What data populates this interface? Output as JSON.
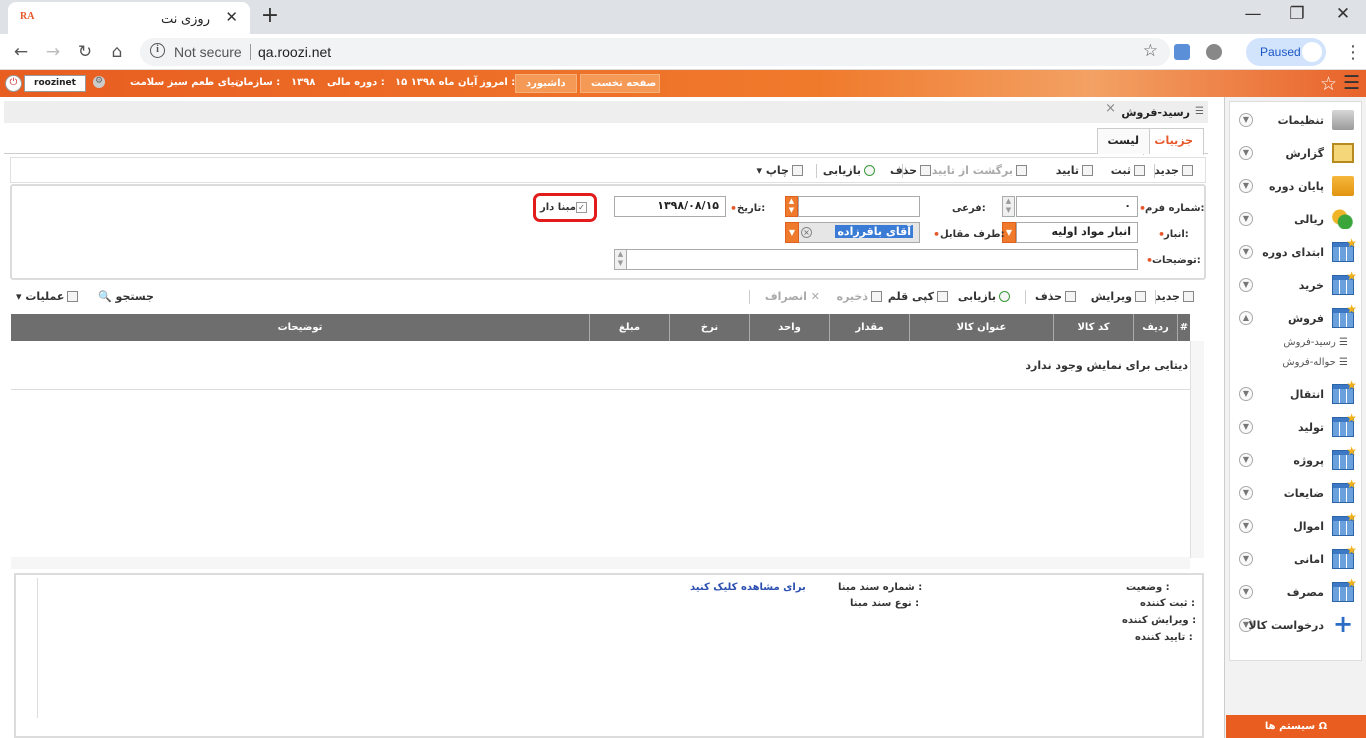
{
  "browser": {
    "tab_title": "روزی نت",
    "favicon_text": "RA",
    "close_tab": "✕",
    "new_tab": "+",
    "address_secure_label": "Not secure",
    "url": "qa.roozi.net",
    "profile_label": "Paused",
    "win_min": "—",
    "win_restore": "❐",
    "win_close": "✕"
  },
  "appbar": {
    "user": "roozinet",
    "org_label": "سازمان :",
    "org_name": "دنیای طعم سبز سلامت",
    "fiscal_label": "دوره مالی :",
    "fiscal_value": "۱۳۹۸",
    "today_label": "امروز :",
    "today_value": "۱۵ آبان ماه ۱۳۹۸",
    "dashboard": "داشبورد",
    "home": "صفحه نخست"
  },
  "page": {
    "title": "رسید-فروش",
    "tabs": [
      "جزییات",
      "لیست"
    ]
  },
  "toolbar": {
    "new": "جدید",
    "save": "ثبت",
    "approve": "تایید",
    "unapprove": "برگشت از تایید",
    "delete": "حذف",
    "reload": "بازیابی",
    "print": "چاپ"
  },
  "form": {
    "form_no_label": "شماره فرم:",
    "form_no_value": "۰",
    "sub_label": "فرعی:",
    "date_label": "تاریخ:",
    "date_value": "۱۳۹۸/۰۸/۱۵",
    "mabna_label": "مبنا دار",
    "warehouse_label": "انبار:",
    "warehouse_value": "انبار مواد اولیه",
    "party_label": "طرف مقابل:",
    "party_value": "آقای باقرزاده",
    "desc_label": "توضیحات:"
  },
  "grid_toolbar": {
    "new": "جدید",
    "edit": "ویرایش",
    "delete": "حذف",
    "reload": "بازیابی",
    "copy": "کپی قلم",
    "save": "ذخیره",
    "cancel": "انصراف",
    "search": "جستجو",
    "ops": "عملیات"
  },
  "grid": {
    "columns": [
      "#",
      "ردیف",
      "کد کالا",
      "عنوان کالا",
      "مقدار",
      "واحد",
      "نرخ",
      "مبلغ",
      "توضیحات"
    ],
    "empty_text": "دیتایی برای نمایش وجود ندارد"
  },
  "info": {
    "status": "وضعیت :",
    "registrar": "ثبت کننده :",
    "editor": "ویرایش کننده :",
    "approver": "تایید کننده :",
    "base_doc_no": "شماره سند مبنا :",
    "base_doc_type": "نوع سند مبنا :",
    "view_link": "برای مشاهده کلیک کنید"
  },
  "sidebar": {
    "items": [
      {
        "label": "تنظیمات",
        "icon": "settings-folder-icon"
      },
      {
        "label": "گزارش",
        "icon": "report-clipboard-icon"
      },
      {
        "label": "پایان دوره",
        "icon": "folders-icon"
      },
      {
        "label": "ریالی",
        "icon": "coins-icon"
      },
      {
        "label": "ابتدای دوره",
        "icon": "grid-star-icon"
      },
      {
        "label": "خرید",
        "icon": "grid-star-icon"
      },
      {
        "label": "فروش",
        "icon": "grid-star-icon"
      },
      {
        "label": "انتقال",
        "icon": "grid-star-icon"
      },
      {
        "label": "تولید",
        "icon": "grid-star-icon"
      },
      {
        "label": "پروژه",
        "icon": "grid-star-icon"
      },
      {
        "label": "ضایعات",
        "icon": "grid-star-icon"
      },
      {
        "label": "اموال",
        "icon": "grid-star-icon"
      },
      {
        "label": "امانی",
        "icon": "grid-star-icon"
      },
      {
        "label": "مصرف",
        "icon": "grid-star-icon"
      },
      {
        "label": "درخواست کالا",
        "icon": "plus-icon"
      }
    ],
    "sub_items": [
      "رسید-فروش",
      "حواله-فروش"
    ],
    "systems_button": "سیستم ها"
  },
  "colors": {
    "accent": "#e8572a",
    "highlight_box": "#e21b1b",
    "grid_header": "#6e6e6e"
  }
}
